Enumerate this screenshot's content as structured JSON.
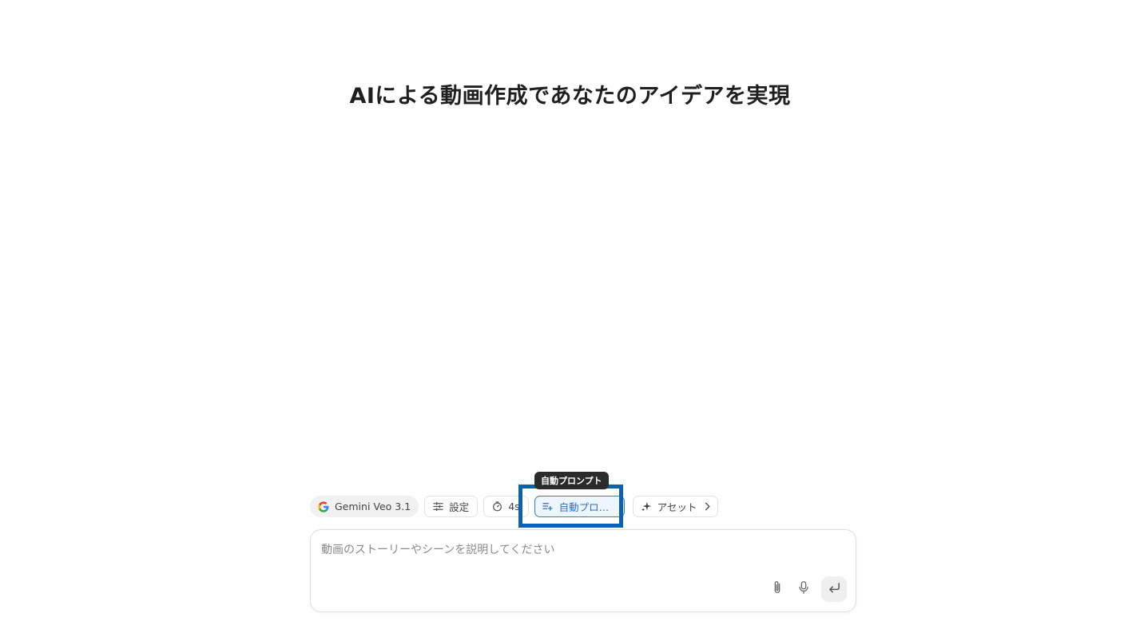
{
  "hero": {
    "title": "AIによる動画作成であなたのアイデアを実現"
  },
  "toolbar": {
    "model_label": "Gemini Veo 3.1",
    "settings_label": "設定",
    "duration_label": "4s",
    "auto_prompt_label": "自動プロ…",
    "assets_label": "アセット"
  },
  "tooltip": {
    "text": "自動プロンプト"
  },
  "composer": {
    "placeholder": "動画のストーリーやシーンを説明してください",
    "value": ""
  },
  "icons": {
    "model": "google-logo-icon",
    "settings": "sliders-icon",
    "duration": "timer-icon",
    "auto_prompt": "list-sparkle-icon",
    "assets": "sparkle-icon",
    "assets_more": "chevron-right-icon",
    "attach": "paperclip-icon",
    "voice": "microphone-icon",
    "send": "enter-icon"
  },
  "colors": {
    "highlight_border": "#0a62b0",
    "auto_prompt_accent": "#2f7fd8",
    "tooltip_bg": "#2b2b2b"
  }
}
